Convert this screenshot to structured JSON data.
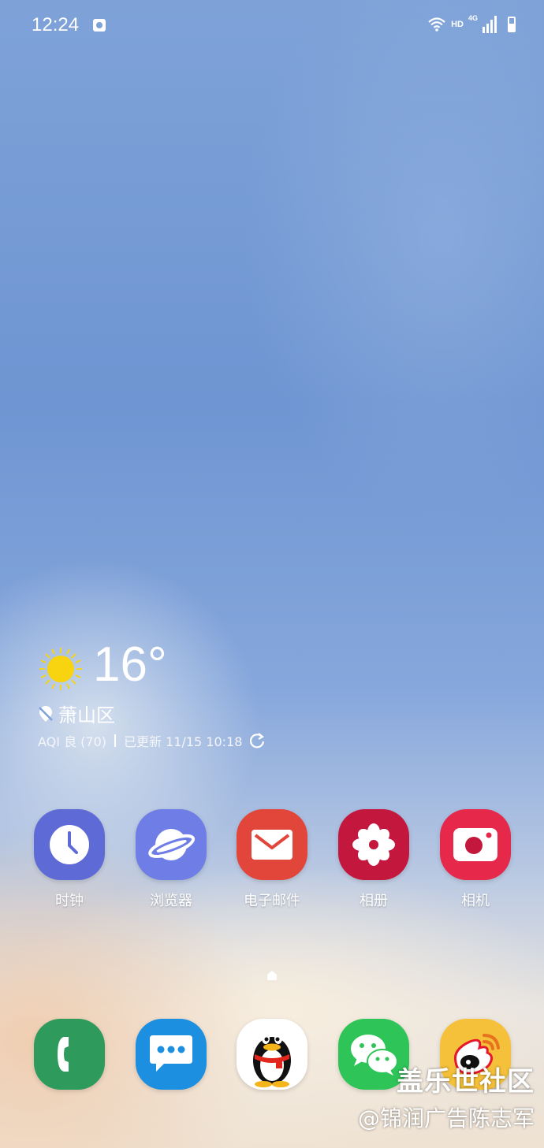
{
  "status_bar": {
    "time": "12:24",
    "hd": "HD",
    "network": "4G",
    "icons": [
      "notification-app-icon",
      "wifi-icon",
      "signal-icon",
      "battery-icon"
    ]
  },
  "weather": {
    "temperature": "16°",
    "location": "萧山区",
    "aqi": "AQI 良 (70)",
    "updated": "已更新 11/15 10:18",
    "icons": [
      "sun-icon",
      "location-off-icon",
      "refresh-icon"
    ]
  },
  "apps": [
    {
      "label": "时钟",
      "icon": "clock-icon",
      "color": "#5e6bd6"
    },
    {
      "label": "浏览器",
      "icon": "planet-icon",
      "color": "#6f7ee6"
    },
    {
      "label": "电子邮件",
      "icon": "mail-icon",
      "color": "#e2453a"
    },
    {
      "label": "相册",
      "icon": "flower-icon",
      "color": "#c3173d"
    },
    {
      "label": "相机",
      "icon": "camera-icon",
      "color": "#e6284b"
    }
  ],
  "dock": [
    {
      "icon": "phone-icon",
      "color": "#2e9a5b"
    },
    {
      "icon": "message-icon",
      "color": "#1d8fe0"
    },
    {
      "icon": "qq-icon",
      "color": "#ffffff"
    },
    {
      "icon": "wechat-icon",
      "color": "#2fc457"
    },
    {
      "icon": "weibo-icon",
      "color": "#f5c13a"
    }
  ],
  "watermark": {
    "line1": "盖乐世社区",
    "line2": "@锦润广告陈志军"
  }
}
